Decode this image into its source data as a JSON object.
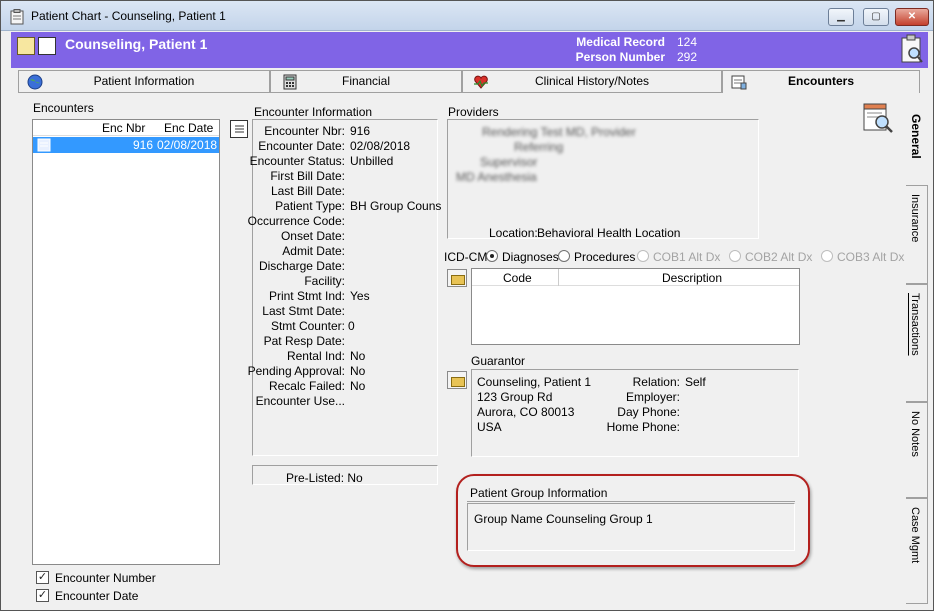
{
  "window": {
    "title": "Patient Chart - Counseling, Patient 1",
    "controls": {
      "minimize": "▁",
      "maximize": "▢",
      "close": "✕"
    }
  },
  "header": {
    "patient_name": "Counseling, Patient 1",
    "medical_record_label": "Medical Record",
    "medical_record_value": "124",
    "person_number_label": "Person Number",
    "person_number_value": "292",
    "background_color": "#8064e6"
  },
  "tabs": [
    {
      "label": "Patient Information",
      "icon": "globe-icon"
    },
    {
      "label": "Financial",
      "icon": "calculator-icon"
    },
    {
      "label": "Clinical History/Notes",
      "icon": "heart-chart-icon"
    },
    {
      "label": "Encounters",
      "icon": "encounter-icon",
      "active": true
    }
  ],
  "encounters": {
    "section_label": "Encounters",
    "columns": [
      "Enc Nbr",
      "Enc Date"
    ],
    "rows": [
      {
        "enc_nbr": "916",
        "enc_date": "02/08/2018"
      }
    ],
    "checkboxes": [
      {
        "label": "Encounter Number",
        "checked": true
      },
      {
        "label": "Encounter Date",
        "checked": true
      }
    ]
  },
  "encounter_info": {
    "section_label": "Encounter Information",
    "fields": [
      {
        "label": "Encounter Nbr:",
        "value": "916"
      },
      {
        "label": "Encounter Date:",
        "value": "02/08/2018"
      },
      {
        "label": "Encounter Status:",
        "value": "Unbilled"
      },
      {
        "label": "First Bill Date:",
        "value": ""
      },
      {
        "label": "Last Bill Date:",
        "value": ""
      },
      {
        "label": "Patient Type:",
        "value": "BH Group Couns"
      },
      {
        "label": "Occurrence Code:",
        "value": ""
      },
      {
        "label": "Onset Date:",
        "value": ""
      },
      {
        "label": "Admit Date:",
        "value": ""
      },
      {
        "label": "Discharge Date:",
        "value": ""
      },
      {
        "label": "Facility:",
        "value": ""
      },
      {
        "label": "Print Stmt Ind:",
        "value": "Yes"
      },
      {
        "label": "Last Stmt Date:",
        "value": ""
      },
      {
        "label": "Stmt Counter:",
        "value": "0"
      },
      {
        "label": "Pat Resp Date:",
        "value": ""
      },
      {
        "label": "Rental Ind:",
        "value": "No"
      },
      {
        "label": "Pending Approval:",
        "value": "No"
      },
      {
        "label": "Recalc Failed:",
        "value": "No"
      },
      {
        "label": "Encounter Use...",
        "value": ""
      }
    ],
    "pre_listed": "Pre-Listed: No"
  },
  "providers": {
    "section_label": "Providers",
    "blurred_lines": [
      "Rendering Test MD, Provider",
      "Referring",
      "Supervisor",
      "MD Anesthesia"
    ],
    "location_label": "Location:",
    "location_value": "Behavioral Health Location"
  },
  "icd": {
    "label": "ICD-CM",
    "options": [
      {
        "label": "Diagnoses",
        "selected": true,
        "enabled": true
      },
      {
        "label": "Procedures",
        "selected": false,
        "enabled": true
      },
      {
        "label": "COB1 Alt Dx",
        "selected": false,
        "enabled": false
      },
      {
        "label": "COB2 Alt Dx",
        "selected": false,
        "enabled": false
      },
      {
        "label": "COB3 Alt Dx",
        "selected": false,
        "enabled": false
      }
    ],
    "columns": [
      "Code",
      "Description"
    ]
  },
  "guarantor": {
    "section_label": "Guarantor",
    "name": "Counseling, Patient 1",
    "address1": "123 Group Rd",
    "address2": "Aurora, CO 80013",
    "country": "USA",
    "relation_label": "Relation:",
    "relation_value": "Self",
    "employer_label": "Employer:",
    "day_phone_label": "Day Phone:",
    "home_phone_label": "Home Phone:"
  },
  "patient_group": {
    "section_label": "Patient Group Information",
    "group_name_label": "Group Name :",
    "group_name_value": "Counseling Group 1",
    "highlight_color": "#b3201e"
  },
  "side_tabs": [
    {
      "label": "General",
      "active": true
    },
    {
      "label": "Insurance",
      "active": false
    },
    {
      "label": "Transactions",
      "active": false
    },
    {
      "label": "No Notes",
      "active": false
    },
    {
      "label": "Case Mgmt",
      "active": false
    }
  ]
}
